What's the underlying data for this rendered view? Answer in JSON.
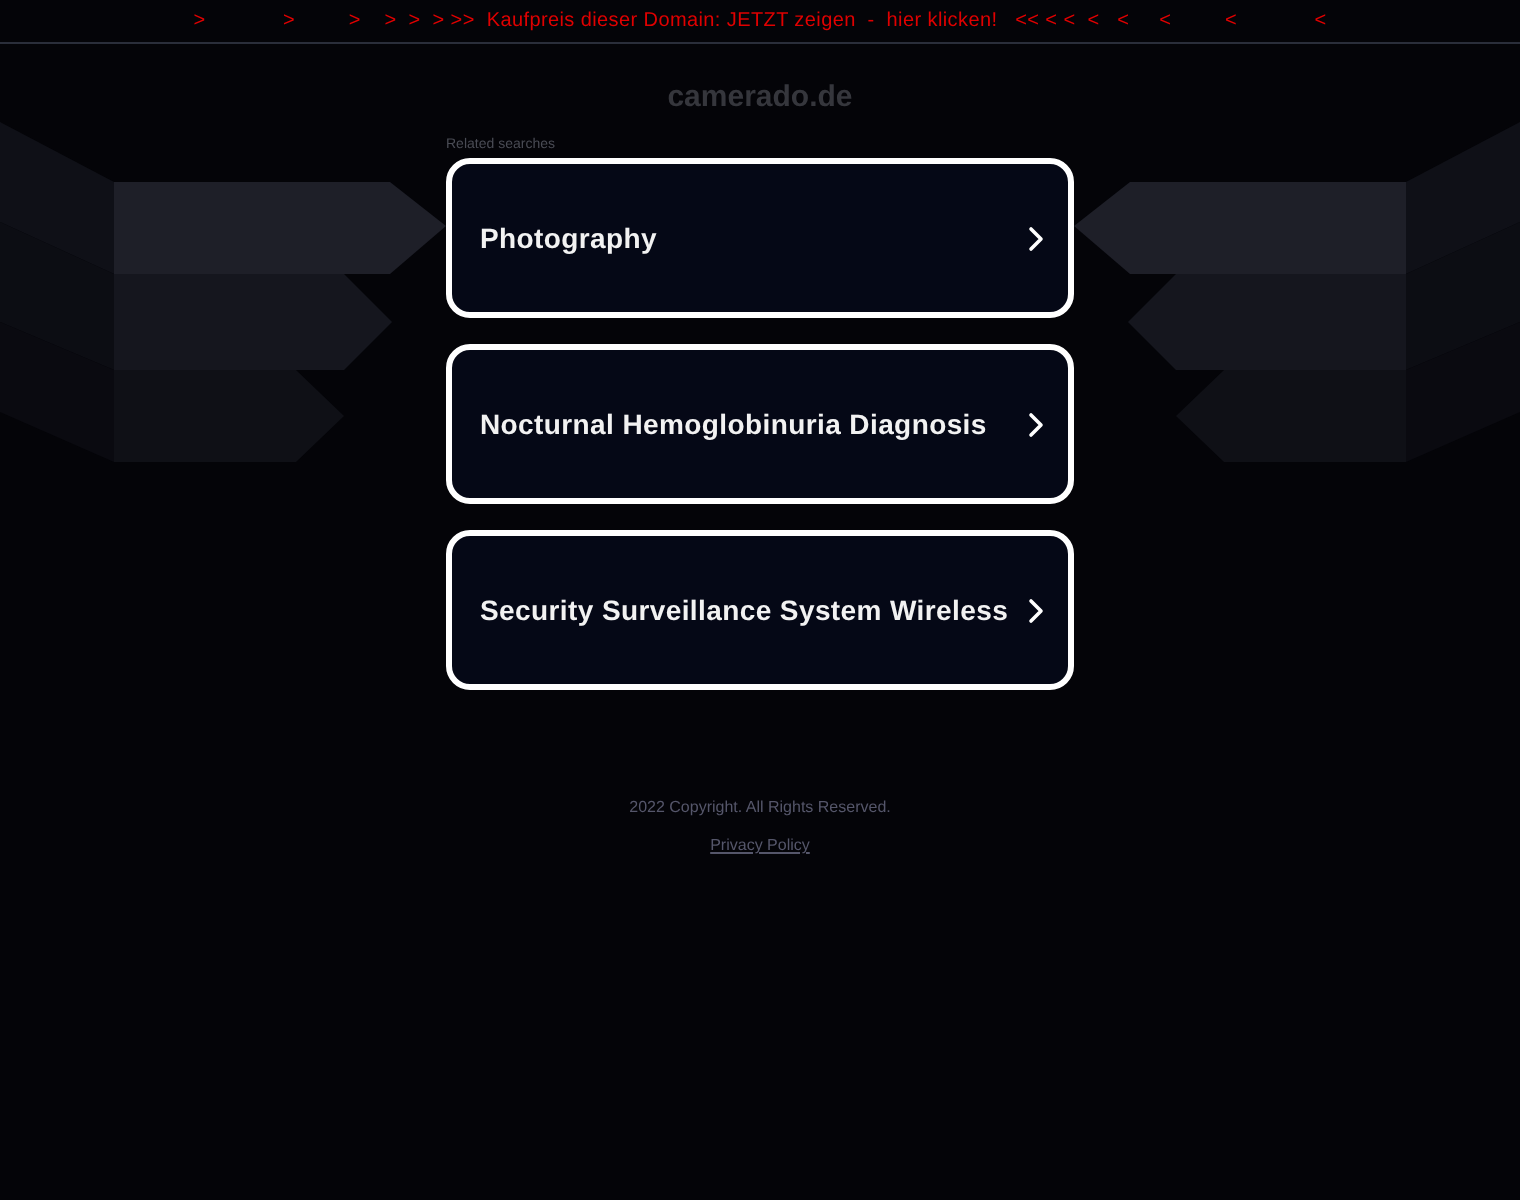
{
  "banner": {
    "text": ">             >         >    >  >  > >>  Kaufpreis dieser Domain: JETZT zeigen  -  hier klicken!   << < <  <   <     <         <             <"
  },
  "site": {
    "domain": "camerado.de"
  },
  "related": {
    "heading": "Related searches",
    "items": [
      {
        "label": "Photography"
      },
      {
        "label": "Nocturnal Hemoglobinuria Diagnosis"
      },
      {
        "label": "Security Surveillance System Wireless"
      }
    ]
  },
  "footer": {
    "copyright": "2022 Copyright. All Rights Reserved.",
    "link": "Privacy Policy"
  }
}
